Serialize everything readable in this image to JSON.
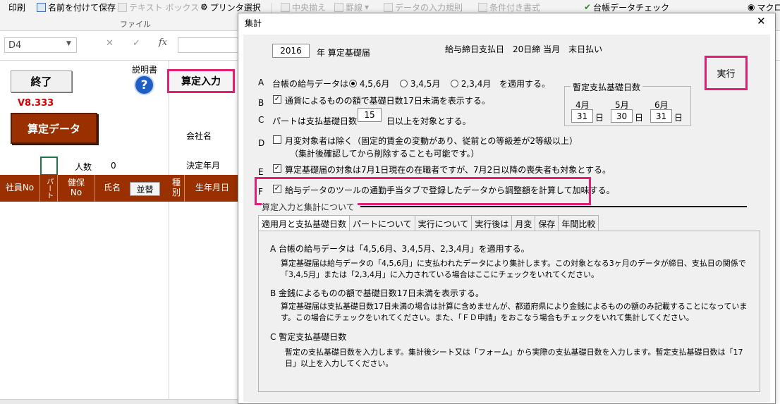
{
  "ribbon": {
    "items": [
      {
        "label": "印刷",
        "dim": false
      },
      {
        "label": "名前を付けて保存",
        "dim": false
      },
      {
        "label": "テキスト ボックス",
        "dim": true
      },
      {
        "label": "プリンタ選択",
        "dim": false
      },
      {
        "label": "中央揃え",
        "dim": true
      },
      {
        "label": "罫線",
        "dim": true
      },
      {
        "label": "データの入力規則",
        "dim": true
      },
      {
        "label": "条件付き書式",
        "dim": true
      },
      {
        "label": "台帳データチェック",
        "dim": false
      },
      {
        "label": "マクロ",
        "dim": false
      }
    ],
    "group_label": "ファイル"
  },
  "formula_bar": {
    "cell_ref": "D4",
    "cancel": "✕",
    "enter": "✓",
    "fx": "fx"
  },
  "sheet": {
    "end_button": "終了",
    "version": "V8.333",
    "calc_data_button": "算定データ",
    "manual_label": "説明書",
    "help_icon": "?",
    "input_button": "算定入力",
    "company_label": "会社名",
    "decided_month_label": "決定年月",
    "count_label": "人数",
    "count_value": "0",
    "headers": {
      "employee_no": "社員No",
      "part": "パート",
      "health_no": "健保No",
      "name": "氏名",
      "sort_button": "並替",
      "type": "種別",
      "birth": "生年月日"
    }
  },
  "dialog": {
    "title": "集計",
    "close": "✕",
    "year_value": "2016",
    "year_label": "年 算定基礎届",
    "pay_info": "給与締日支払日　20日締 当月　末日払い",
    "run_button": "実行",
    "row_a": {
      "letter": "A",
      "text": "台帳の給与データは",
      "options": [
        "4,5,6月",
        "3,4,5月",
        "2,3,4月"
      ],
      "suffix": "を適用する。"
    },
    "row_b": {
      "letter": "B",
      "text": "通貨によるものの額で基礎日数17日未満を表示する。",
      "checked": true
    },
    "row_c": {
      "letter": "C",
      "text": "パートは支払基礎日数",
      "value": "15",
      "suffix": "日以上を対象とする。"
    },
    "provisional": {
      "title": "暫定支払基礎日数",
      "months": [
        {
          "month": "4月",
          "days": "31",
          "unit": "日"
        },
        {
          "month": "5月",
          "days": "30",
          "unit": "日"
        },
        {
          "month": "6月",
          "days": "31",
          "unit": "日"
        }
      ]
    },
    "row_d": {
      "letter": "D",
      "text": "月変対象者は除く（固定的賃金の変動があり、従前との等級差が2等級以上）",
      "note": "（集計後確認してから削除することも可能です。）",
      "checked": false
    },
    "row_e": {
      "letter": "E",
      "text": "算定基礎届の対象は7月1日現在の在職者ですが、7月2日以降の喪失者も対象とする。",
      "checked": true
    },
    "row_f": {
      "letter": "F",
      "text": "給与データのツールの通勤手当タブで登録したデータから調整額を計算して加味する。",
      "checked": true
    },
    "tabs_caption": "算定入力と集計について",
    "tabs": [
      "適用月と支払基礎日数",
      "パートについて",
      "実行について",
      "実行後は",
      "月変",
      "保存",
      "年間比較"
    ],
    "help": [
      {
        "title": "A  台帳の給与データは「4,5,6月、3,4,5月、2,3,4月」を適用する。",
        "lines": [
          "算定基礎届は給与データの「4,5,6月」に支払われたデータにより集計します。この対象となる3ヶ月のデータが締日、支払日の関係で",
          "「3,4,5月」または「2,3,4月」に入力されている場合はここにチェックをいれてください。"
        ]
      },
      {
        "title": "B  金銭によるものの額で基礎日数17日未満を表示する。",
        "lines": [
          "算定基礎届は支払基礎日数17日未満の場合は計算に含めませんが、都道府県により金銭によるものの額のみ記載することになっていま",
          "す。この場合にチェックをいれてください。また、「ＦＤ申請」をおこなう場合もチェックをいれて集計してください。"
        ]
      },
      {
        "title": "C  暫定支払基礎日数",
        "lines": [
          "暫定の支払基礎日数を入力します。集計後シート又は「フォーム」から実際の支払基礎日数を入力します。暫定支払基礎日数は「17",
          "日」以上を入力してください。"
        ]
      }
    ]
  }
}
